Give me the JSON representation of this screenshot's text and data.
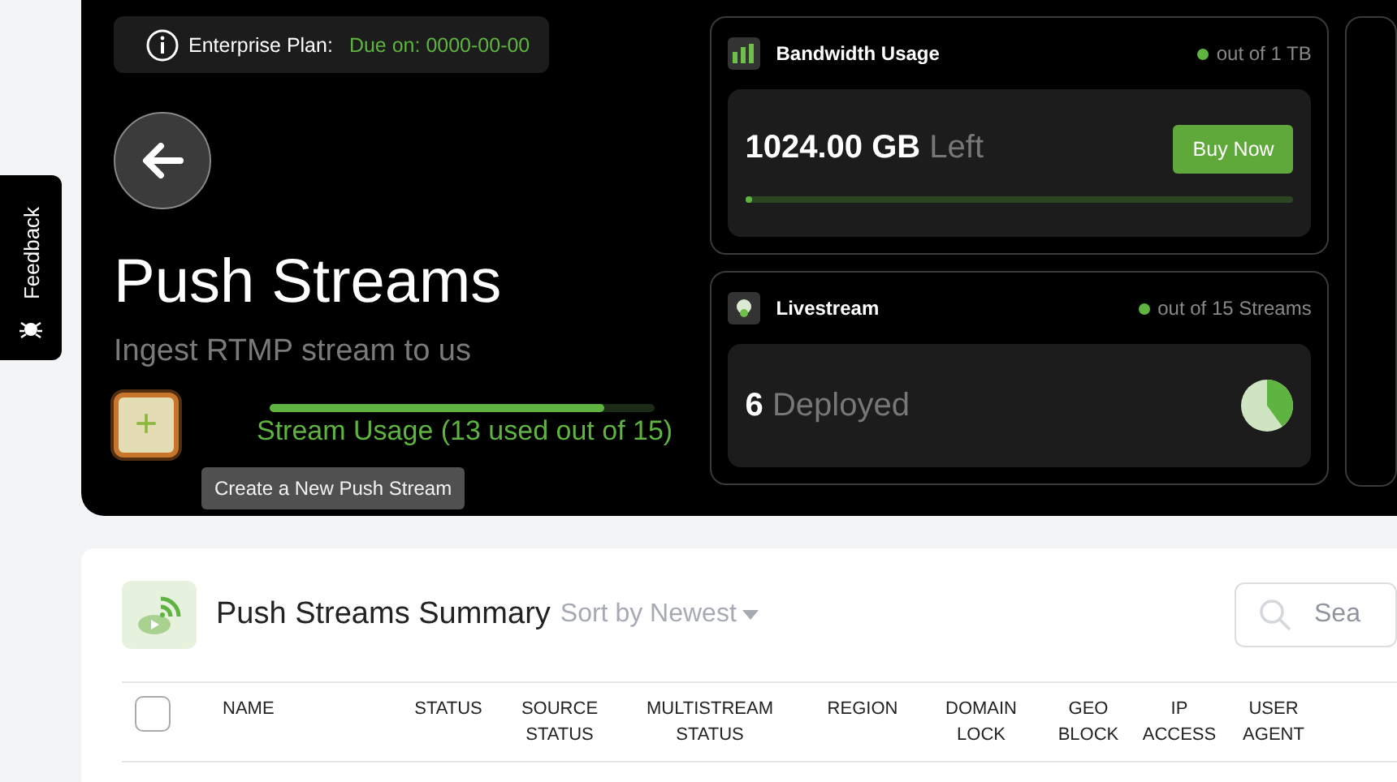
{
  "feedback_tab": {
    "label": "Feedback"
  },
  "plan_banner": {
    "label": "Enterprise Plan:",
    "due": "Due on: 0000-00-00"
  },
  "header": {
    "title": "Push Streams",
    "subtitle": "Ingest RTMP stream to us"
  },
  "stream_usage": {
    "label": "Stream Usage (13 used out of 15)",
    "level": 0.87
  },
  "add_button": {
    "label": "+"
  },
  "tooltip": {
    "text": "Create a New Push Stream"
  },
  "bandwidth_card": {
    "title": "Bandwidth Usage",
    "legend": "out of 1 TB",
    "value": "1024.00 GB",
    "suffix": "Left",
    "button": "Buy Now",
    "level": 0.005
  },
  "livestream_card": {
    "title": "Livestream",
    "legend": "out of 15 Streams",
    "value": "6",
    "suffix": "Deployed"
  },
  "summary": {
    "title": "Push Streams Summary",
    "sort": "Sort by Newest",
    "search_placeholder": "Sea",
    "columns": [
      [
        "NAME"
      ],
      [
        "STATUS"
      ],
      [
        "SOURCE",
        "STATUS"
      ],
      [
        "MULTISTREAM",
        "STATUS"
      ],
      [
        "REGION"
      ],
      [
        "DOMAIN",
        "LOCK"
      ],
      [
        "GEO",
        "BLOCK"
      ],
      [
        "IP",
        "ACCESS"
      ],
      [
        "USER",
        "AGENT"
      ]
    ],
    "select_all_checked": false
  }
}
